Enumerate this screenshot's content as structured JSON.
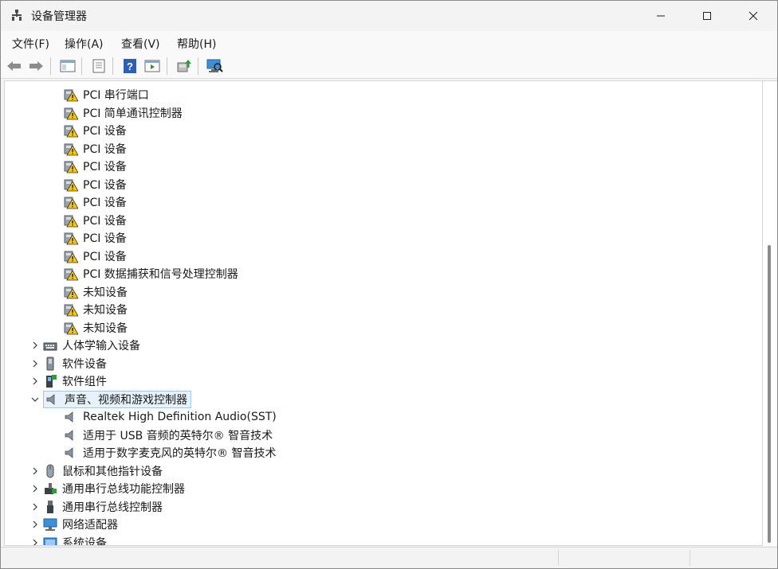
{
  "window": {
    "title": "设备管理器",
    "icons": {
      "app": "device-manager-icon",
      "minimize": "minimize-icon",
      "maximize": "maximize-icon",
      "close": "close-icon"
    }
  },
  "menu": [
    "文件(F)",
    "操作(A)",
    "查看(V)",
    "帮助(H)"
  ],
  "toolbar": {
    "buttons": [
      "back-arrow-icon",
      "forward-arrow-icon",
      "show-hide-console-tree-icon",
      "properties-icon",
      "help-icon",
      "action-pane-icon",
      "update-driver-icon",
      "scan-hardware-changes-icon"
    ]
  },
  "tree": {
    "warning_items": [
      "PCI 串行端口",
      "PCI 简单通讯控制器",
      "PCI 设备",
      "PCI 设备",
      "PCI 设备",
      "PCI 设备",
      "PCI 设备",
      "PCI 设备",
      "PCI 设备",
      "PCI 设备",
      "PCI 数据捕获和信号处理控制器",
      "未知设备",
      "未知设备",
      "未知设备"
    ],
    "categories_before": [
      {
        "label": "人体学输入设备",
        "icon": "hid-icon"
      },
      {
        "label": "软件设备",
        "icon": "software-device-icon"
      },
      {
        "label": "软件组件",
        "icon": "software-component-icon"
      }
    ],
    "selected_category": {
      "label": "声音、视频和游戏控制器",
      "icon": "speaker-icon"
    },
    "audio_items": [
      "Realtek High Definition Audio(SST)",
      "适用于 USB 音频的英特尔® 智音技术",
      "适用于数字麦克风的英特尔® 智音技术"
    ],
    "categories_after": [
      {
        "label": "鼠标和其他指针设备",
        "icon": "mouse-icon"
      },
      {
        "label": "通用串行总线功能控制器",
        "icon": "usb-function-controller-icon"
      },
      {
        "label": "通用串行总线控制器",
        "icon": "usb-controller-icon"
      },
      {
        "label": "网络适配器",
        "icon": "network-adapter-icon"
      },
      {
        "label": "系统设备",
        "icon": "system-device-icon"
      }
    ]
  },
  "colors": {
    "selection_bg": "#e5f1fb",
    "selection_border": "#99c9ef",
    "warning_yellow": "#f6c800"
  }
}
